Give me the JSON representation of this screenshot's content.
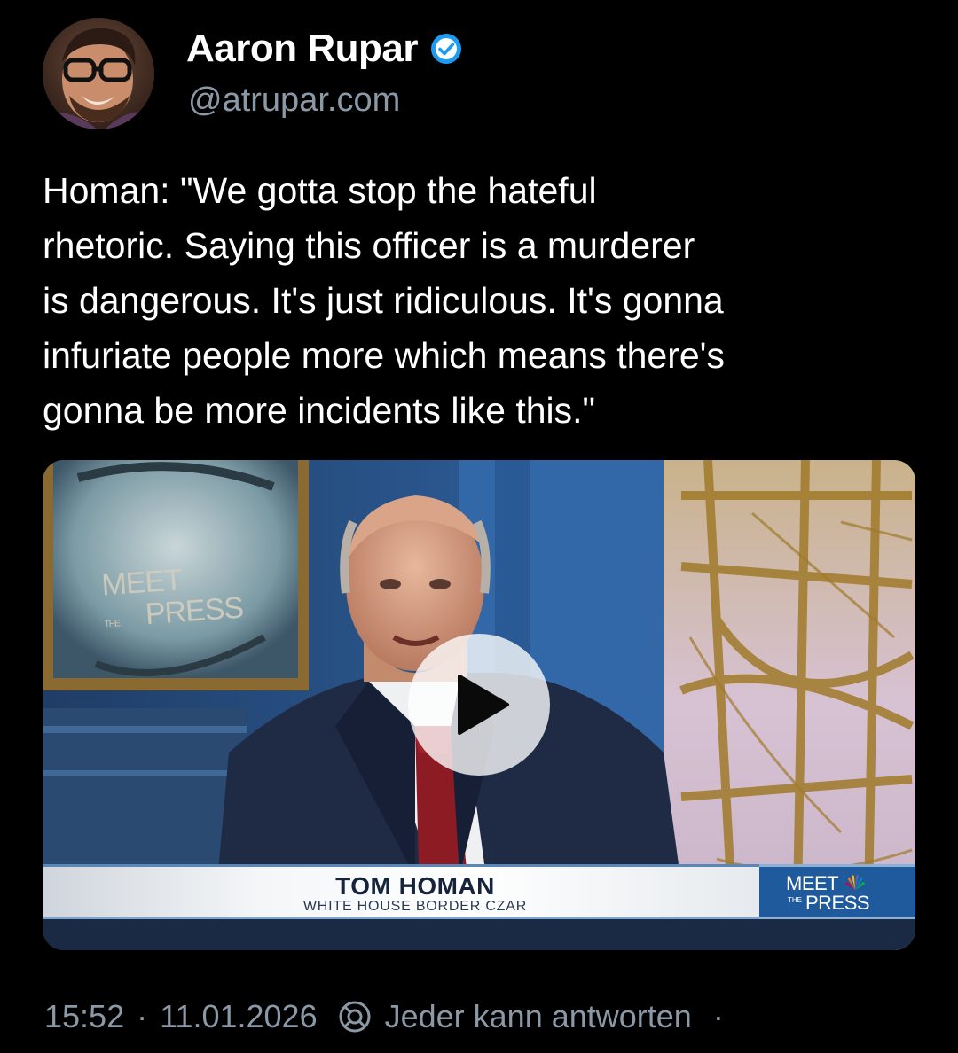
{
  "author": {
    "display_name": "Aaron Rupar",
    "handle": "@atrupar.com",
    "verified": true,
    "avatar_icon": "avatar-photo"
  },
  "post": {
    "text": "Homan: \"We gotta stop the hateful\nrhetoric. Saying this officer is a murderer\nis dangerous. It's just ridiculous. It's gonna\ninfuriate people more which means there's\ngonna be more incidents like this.\""
  },
  "video": {
    "play_icon": "play-icon",
    "background_logo": {
      "meet": "MEET",
      "the": "THE",
      "press": "PRESS"
    },
    "lower_third": {
      "name": "TOM HOMAN",
      "title": "WHITE HOUSE BORDER CZAR",
      "logo_meet": "MEET",
      "logo_the": "THE",
      "logo_press": "PRESS"
    }
  },
  "footer": {
    "time": "15:52",
    "separator": "·",
    "date": "11.01.2026",
    "reply_icon": "reply-settings-icon",
    "reply_setting": "Jeder kann antworten",
    "trailing": "·"
  },
  "colors": {
    "background": "#000000",
    "text": "#ffffff",
    "muted": "#8b98a5",
    "verified": "#1d9bf0",
    "lower_third_logo": "#1f5a9c"
  }
}
